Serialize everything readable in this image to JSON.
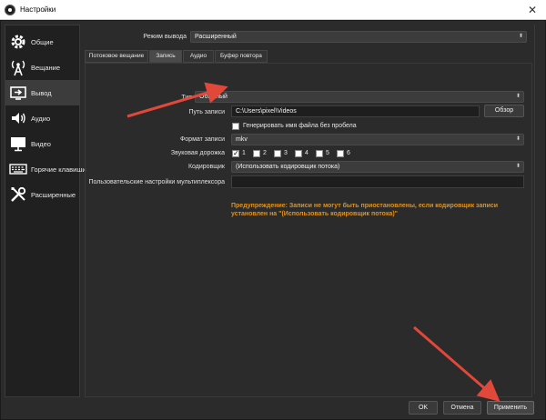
{
  "window": {
    "title": "Настройки",
    "close": "✕"
  },
  "sidebar": {
    "items": [
      {
        "label": "Общие",
        "icon": "gear-icon"
      },
      {
        "label": "Вещание",
        "icon": "broadcast-icon"
      },
      {
        "label": "Вывод",
        "icon": "output-icon"
      },
      {
        "label": "Аудио",
        "icon": "speaker-icon"
      },
      {
        "label": "Видео",
        "icon": "monitor-icon"
      },
      {
        "label": "Горячие клавиши",
        "icon": "keyboard-icon"
      },
      {
        "label": "Расширенные",
        "icon": "tools-icon"
      }
    ],
    "active_index": 2
  },
  "output_mode": {
    "label": "Режим вывода",
    "value": "Расширенный"
  },
  "tabs": [
    "Потоковое вещание",
    "Запись",
    "Аудио",
    "Буфер повтора"
  ],
  "active_tab": 1,
  "recording": {
    "type": {
      "label": "Тип",
      "value": "Обычный"
    },
    "path": {
      "label": "Путь записи",
      "value": "C:\\Users\\pixel\\Videos",
      "browse": "Обзор"
    },
    "no_space": {
      "label": "Генерировать имя файла без пробела",
      "checked": false
    },
    "format": {
      "label": "Формат записи",
      "value": "mkv"
    },
    "tracks": {
      "label": "Звуковая дорожка",
      "items": [
        "1",
        "2",
        "3",
        "4",
        "5",
        "6"
      ],
      "checked": [
        true,
        false,
        false,
        false,
        false,
        false
      ]
    },
    "encoder": {
      "label": "Кодировщик",
      "value": "(Использовать кодировщик потока)"
    },
    "muxer": {
      "label": "Пользовательские настройки мультиплексора",
      "value": ""
    },
    "warning": "Предупреждение: Записи не могут быть приостановлены, если кодировщик записи установлен на \"(Использовать кодировщик потока)\""
  },
  "footer": {
    "ok": "OK",
    "cancel": "Отмена",
    "apply": "Применить"
  },
  "colors": {
    "annotation_arrow": "#e0483a",
    "warning": "#e0921d"
  }
}
